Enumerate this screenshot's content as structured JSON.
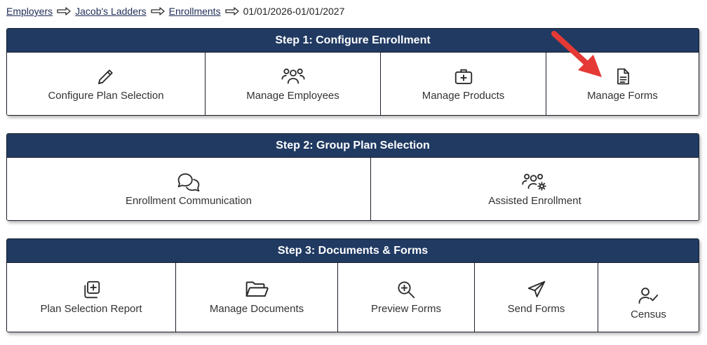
{
  "breadcrumb": {
    "items": [
      "Employers",
      "Jacob's Ladders",
      "Enrollments"
    ],
    "current": "01/01/2026-01/01/2027"
  },
  "step1": {
    "title": "Step 1: Configure Enrollment",
    "tiles": [
      {
        "label": "Configure Plan Selection",
        "icon": "pencil-icon"
      },
      {
        "label": "Manage Employees",
        "icon": "people-icon"
      },
      {
        "label": "Manage Products",
        "icon": "medical-kit-icon"
      },
      {
        "label": "Manage Forms",
        "icon": "document-icon"
      }
    ]
  },
  "step2": {
    "title": "Step 2: Group Plan Selection",
    "tiles": [
      {
        "label": "Enrollment Communication",
        "icon": "chat-bubbles-icon"
      },
      {
        "label": "Assisted Enrollment",
        "icon": "people-gear-icon"
      }
    ]
  },
  "step3": {
    "title": "Step 3: Documents & Forms",
    "tiles": [
      {
        "label": "Plan Selection Report",
        "icon": "copy-plus-icon"
      },
      {
        "label": "Manage Documents",
        "icon": "folder-open-icon"
      },
      {
        "label": "Preview Forms",
        "icon": "zoom-in-icon"
      },
      {
        "label": "Send Forms",
        "icon": "paper-plane-icon"
      },
      {
        "label": "Census",
        "icon": "user-check-icon"
      }
    ]
  },
  "colors": {
    "header_bg": "#203a62",
    "annotation_arrow": "#e53935",
    "link": "#1f2d57"
  }
}
